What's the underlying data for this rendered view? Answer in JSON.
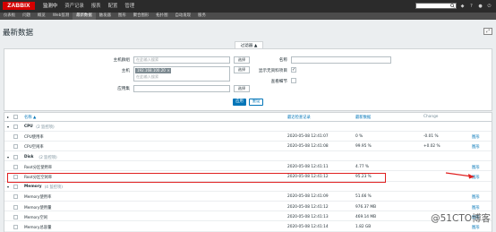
{
  "header": {
    "logo": "ZABBIX",
    "nav": [
      "监测中",
      "资产记录",
      "报表",
      "配置",
      "管理"
    ],
    "active_nav": 0,
    "search_placeholder": "",
    "sub_nav": [
      "仪表板",
      "问题",
      "概览",
      "Web监测",
      "最新数据",
      "触发器",
      "图形",
      "聚合图形",
      "拓扑图",
      "自动发现",
      "服务"
    ],
    "active_sub": 4
  },
  "page": {
    "title": "最新数据",
    "fullscreen_icon": "fullscreen-icon"
  },
  "filter": {
    "tab_label": "过滤器 ▲",
    "host_groups_label": "主机群组",
    "host_groups_placeholder": "在此输入搜索",
    "hosts_label": "主机",
    "host_tag": "192.168.100.20",
    "hosts_placeholder": "在此输入搜索",
    "application_label": "应用集",
    "select_label": "选择",
    "name_label": "名称",
    "show_no_data_label": "显示无资料项目",
    "show_details_label": "查看细节",
    "apply_label": "应用",
    "reset_label": "重设"
  },
  "table": {
    "columns": {
      "name": "名称 ▲",
      "last_check": "最近检查记录",
      "last_value": "最新数据",
      "change": "Change"
    },
    "graph_label": "图形",
    "rows": [
      {
        "type": "group",
        "name": "CPU",
        "sub": "(2 监控项)"
      },
      {
        "type": "item",
        "name": "CPU使用率",
        "time": "2020-05-08 12:41:07",
        "value": "0 %",
        "change": "-0.01 %"
      },
      {
        "type": "item",
        "name": "CPU空闲率",
        "time": "2020-05-08 12:41:08",
        "value": "99.95 %",
        "change": "+0.02 %"
      },
      {
        "type": "group",
        "name": "Disk",
        "sub": "(2 监控项)"
      },
      {
        "type": "item",
        "name": "Root分区使用率",
        "time": "2020-05-08 12:41:11",
        "value": "4.77 %",
        "change": ""
      },
      {
        "type": "item",
        "name": "Root分区空闲率",
        "time": "2020-05-08 12:41:12",
        "value": "95.23 %",
        "change": ""
      },
      {
        "type": "group",
        "name": "Memory",
        "sub": "(4 监控项)"
      },
      {
        "type": "item",
        "name": "Memory使用率",
        "time": "2020-05-08 12:41:09",
        "value": "51.66 %",
        "change": ""
      },
      {
        "type": "item",
        "name": "Memory使用量",
        "time": "2020-05-08 12:41:12",
        "value": "976.37 MB",
        "change": ""
      },
      {
        "type": "item",
        "name": "Memory空闲",
        "time": "2020-05-08 12:41:13",
        "value": "469.14 MB",
        "change": ""
      },
      {
        "type": "item",
        "name": "Memory总容量",
        "time": "2020-05-08 12:41:14",
        "value": "1.82 GB",
        "change": ""
      }
    ]
  },
  "watermark": "@51CTO博客",
  "colors": {
    "brand": "#d40000",
    "accent": "#0275b8",
    "highlight": "#e02020"
  }
}
